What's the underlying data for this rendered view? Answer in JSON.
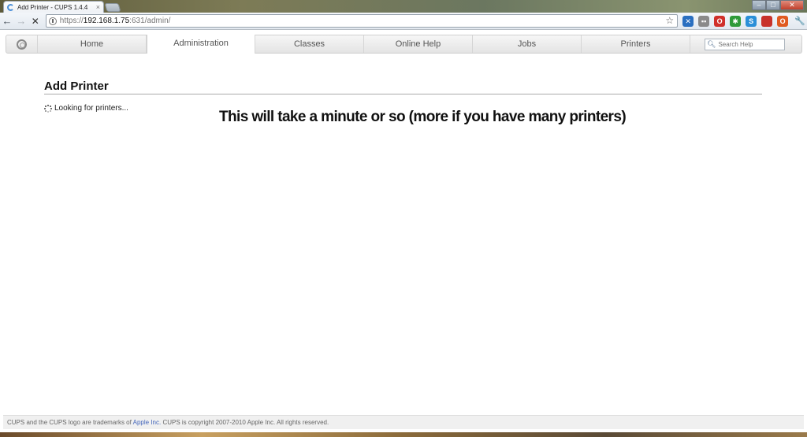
{
  "browser": {
    "tab_title": "Add Printer - CUPS 1.4.4",
    "tab_close": "×",
    "window_buttons": {
      "minimize": "–",
      "maximize": "□",
      "close": "✕"
    },
    "nav": {
      "back": "←",
      "forward": "→",
      "stop": "✕"
    },
    "url": {
      "protocol": "https://",
      "host": "192.168.1.75",
      "path": ":631/admin/"
    },
    "star": "☆",
    "extensions": [
      {
        "name": "extension-blue",
        "label": "✕",
        "color": "#2a6fc0"
      },
      {
        "name": "extension-gray",
        "label": "▪▪",
        "color": "#8a8a8a"
      },
      {
        "name": "opera-icon",
        "label": "O",
        "color": "#d0302a"
      },
      {
        "name": "extension-green",
        "label": "✱",
        "color": "#2f9a3a"
      },
      {
        "name": "skype-icon",
        "label": "S",
        "color": "#2a8fd8"
      },
      {
        "name": "extension-red-book",
        "label": "",
        "color": "#c8322a"
      },
      {
        "name": "extension-orange",
        "label": "O",
        "color": "#e05a20"
      }
    ],
    "wrench": "🔧"
  },
  "cups_nav": {
    "tabs": [
      {
        "id": "home",
        "label": "Home",
        "active": false
      },
      {
        "id": "administration",
        "label": "Administration",
        "active": true
      },
      {
        "id": "classes",
        "label": "Classes",
        "active": false
      },
      {
        "id": "online-help",
        "label": "Online Help",
        "active": false
      },
      {
        "id": "jobs",
        "label": "Jobs",
        "active": false
      },
      {
        "id": "printers",
        "label": "Printers",
        "active": false
      }
    ],
    "search_placeholder": "Search Help"
  },
  "main": {
    "heading": "Add Printer",
    "status": "Looking for printers...",
    "annotation": "This will take a minute or so (more if you have many printers)"
  },
  "footer": {
    "text_before": "CUPS and the CUPS logo are trademarks of ",
    "link": "Apple Inc.",
    "text_after": " CUPS is copyright 2007-2010 Apple Inc. All rights reserved."
  }
}
